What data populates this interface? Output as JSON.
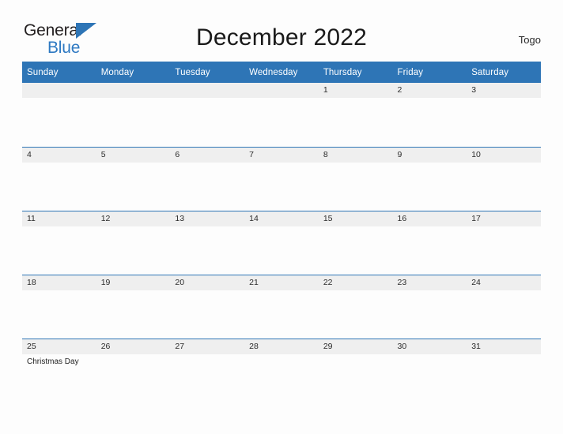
{
  "brand": {
    "name_part1": "General",
    "name_part2": "Blue",
    "triangle_color": "#2E75B6",
    "text_color": "#231F20",
    "blue_text_color": "#2E79C2"
  },
  "header": {
    "title": "December 2022",
    "region": "Togo"
  },
  "theme": {
    "header_blue": "#2E75B6",
    "date_band_gray": "#EFEFEF",
    "row_divider_blue": "#2E75B6",
    "page_background": "#FDFDFD",
    "text_dark": "#2B2B2B"
  },
  "calendar": {
    "month": "December",
    "year": "2022",
    "weekday_headers": [
      "Sunday",
      "Monday",
      "Tuesday",
      "Wednesday",
      "Thursday",
      "Friday",
      "Saturday"
    ],
    "weeks": [
      [
        {
          "date": "",
          "events": []
        },
        {
          "date": "",
          "events": []
        },
        {
          "date": "",
          "events": []
        },
        {
          "date": "",
          "events": []
        },
        {
          "date": "1",
          "events": []
        },
        {
          "date": "2",
          "events": []
        },
        {
          "date": "3",
          "events": []
        }
      ],
      [
        {
          "date": "4",
          "events": []
        },
        {
          "date": "5",
          "events": []
        },
        {
          "date": "6",
          "events": []
        },
        {
          "date": "7",
          "events": []
        },
        {
          "date": "8",
          "events": []
        },
        {
          "date": "9",
          "events": []
        },
        {
          "date": "10",
          "events": []
        }
      ],
      [
        {
          "date": "11",
          "events": []
        },
        {
          "date": "12",
          "events": []
        },
        {
          "date": "13",
          "events": []
        },
        {
          "date": "14",
          "events": []
        },
        {
          "date": "15",
          "events": []
        },
        {
          "date": "16",
          "events": []
        },
        {
          "date": "17",
          "events": []
        }
      ],
      [
        {
          "date": "18",
          "events": []
        },
        {
          "date": "19",
          "events": []
        },
        {
          "date": "20",
          "events": []
        },
        {
          "date": "21",
          "events": []
        },
        {
          "date": "22",
          "events": []
        },
        {
          "date": "23",
          "events": []
        },
        {
          "date": "24",
          "events": []
        }
      ],
      [
        {
          "date": "25",
          "events": [
            "Christmas Day"
          ]
        },
        {
          "date": "26",
          "events": []
        },
        {
          "date": "27",
          "events": []
        },
        {
          "date": "28",
          "events": []
        },
        {
          "date": "29",
          "events": []
        },
        {
          "date": "30",
          "events": []
        },
        {
          "date": "31",
          "events": []
        }
      ]
    ]
  }
}
